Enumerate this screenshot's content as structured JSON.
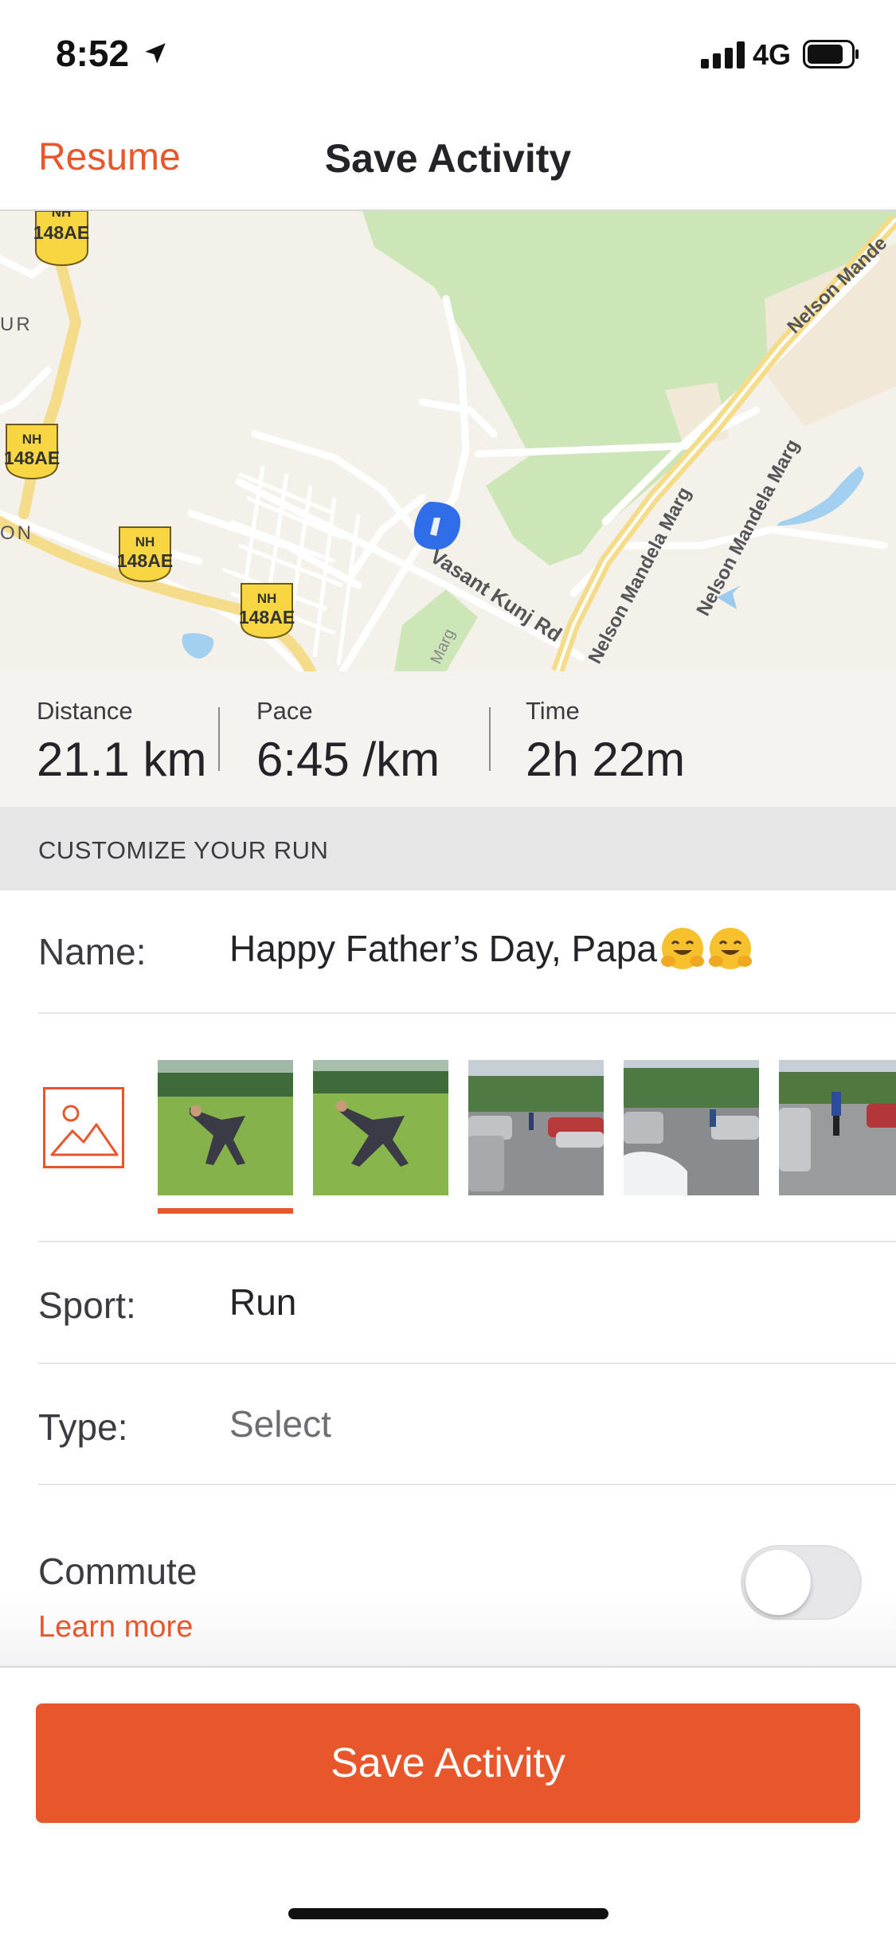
{
  "status_bar": {
    "time": "8:52",
    "network": "4G"
  },
  "nav": {
    "back_label": "Resume",
    "title": "Save Activity"
  },
  "map": {
    "shields": [
      {
        "line1": "NH",
        "line2": "148AE"
      },
      {
        "line1": "NH",
        "line2": "148AE"
      },
      {
        "line1": "NH",
        "line2": "148AE"
      },
      {
        "line1": "NH",
        "line2": "148AE"
      }
    ],
    "labels": {
      "road_1": "Vasant Kunj Rd",
      "road_2": "Nelson Mandela Marg",
      "road_3": "Nelson Mandela Marg",
      "road_4": "Nelson Mande",
      "road_5": "Marg",
      "area_1": "UR",
      "area_2": "ON"
    }
  },
  "stats": [
    {
      "label": "Distance",
      "value": "21.1 km"
    },
    {
      "label": "Pace",
      "value": "6:45 /km"
    },
    {
      "label": "Time",
      "value": "2h 22m"
    }
  ],
  "customize": {
    "header": "CUSTOMIZE YOUR RUN",
    "name_label": "Name:",
    "name_value": "Happy Father’s Day, Papa",
    "sport_label": "Sport:",
    "sport_value": "Run",
    "type_label": "Type:",
    "type_placeholder": "Select",
    "commute_label": "Commute",
    "learn_more": "Learn more"
  },
  "colors": {
    "accent": "#e8572c"
  },
  "save_button": "Save Activity"
}
